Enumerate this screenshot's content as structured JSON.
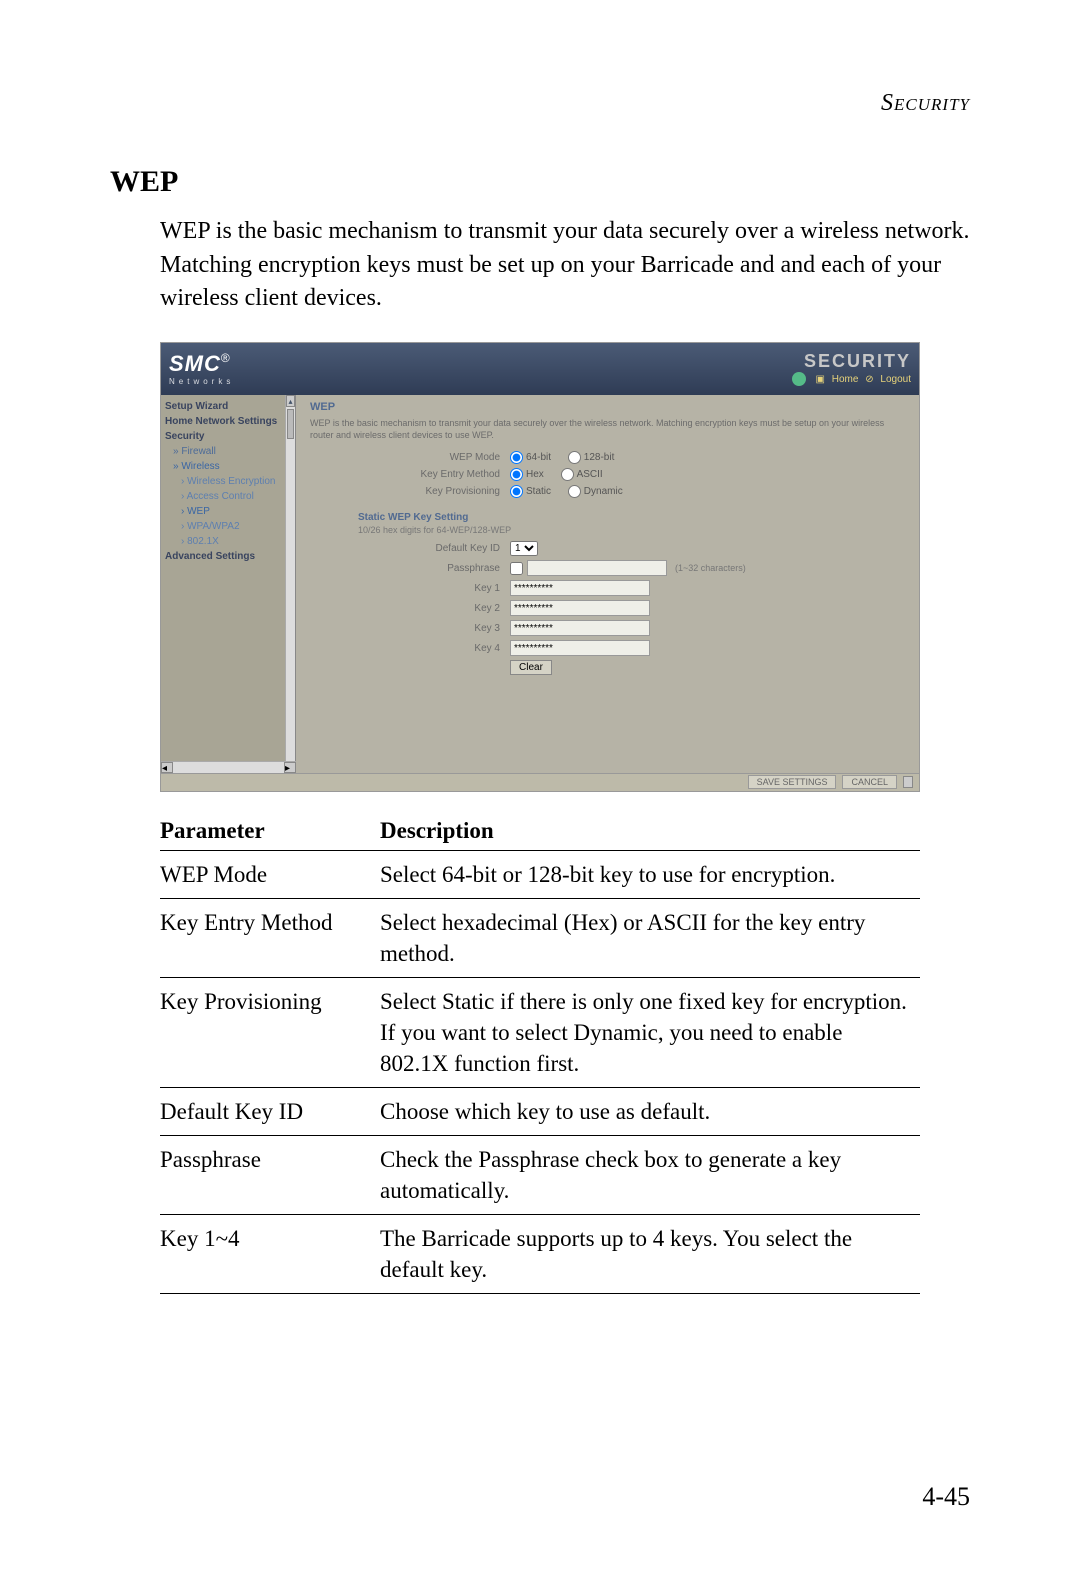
{
  "page": {
    "breadcrumb": "Security",
    "section_title": "WEP",
    "intro": "WEP is the basic mechanism to transmit your data securely over a wireless network. Matching encryption keys must be set up on your Barricade and and each of your wireless client devices.",
    "page_number": "4-45"
  },
  "screenshot": {
    "logo": "SMC",
    "logo_sub": "Networks",
    "banner_title": "SECURITY",
    "link_home": "Home",
    "link_logout": "Logout",
    "sidebar": {
      "items": [
        {
          "label": "Setup Wizard",
          "cls": "top-item"
        },
        {
          "label": "Home Network Settings",
          "cls": "top-item"
        },
        {
          "label": "Security",
          "cls": "top-item"
        },
        {
          "label": "Firewall",
          "cls": "sub"
        },
        {
          "label": "Wireless",
          "cls": "sub active"
        },
        {
          "label": "Wireless Encryption",
          "cls": "sub2"
        },
        {
          "label": "Access Control",
          "cls": "sub2"
        },
        {
          "label": "WEP",
          "cls": "sub2 active"
        },
        {
          "label": "WPA/WPA2",
          "cls": "sub2"
        },
        {
          "label": "802.1X",
          "cls": "sub2"
        },
        {
          "label": "Advanced Settings",
          "cls": "top-item"
        }
      ]
    },
    "content": {
      "title": "WEP",
      "desc": "WEP is the basic mechanism to transmit your data securely over the wireless network. Matching encryption keys must be setup on your wireless router and wireless client devices to use WEP.",
      "wep_mode_label": "WEP Mode",
      "wep_mode_opt1": "64-bit",
      "wep_mode_opt2": "128-bit",
      "entry_label": "Key Entry Method",
      "entry_opt1": "Hex",
      "entry_opt2": "ASCII",
      "prov_label": "Key Provisioning",
      "prov_opt1": "Static",
      "prov_opt2": "Dynamic",
      "static_head": "Static WEP Key Setting",
      "hint": "10/26 hex digits for 64-WEP/128-WEP",
      "default_key_label": "Default Key ID",
      "default_key_value": "1",
      "pass_label": "Passphrase",
      "pass_note": "(1~32 characters)",
      "key1_label": "Key 1",
      "key2_label": "Key 2",
      "key3_label": "Key 3",
      "key4_label": "Key 4",
      "key_value": "**********",
      "clear_btn": "Clear",
      "save_btn": "SAVE SETTINGS",
      "cancel_btn": "CANCEL"
    }
  },
  "table": {
    "h1": "Parameter",
    "h2": "Description",
    "rows": [
      {
        "p": "WEP Mode",
        "d": "Select 64-bit or 128-bit key to use for encryption."
      },
      {
        "p": "Key Entry Method",
        "d": "Select hexadecimal (Hex) or ASCII for the key entry method."
      },
      {
        "p": "Key Provisioning",
        "d": "Select Static if there is only one fixed key for encryption. If you want to select Dynamic, you need to enable 802.1X function first."
      },
      {
        "p": "Default Key ID",
        "d": "Choose which key to use as default."
      },
      {
        "p": "Passphrase",
        "d": "Check the Passphrase check box to generate a key automatically."
      },
      {
        "p": "Key 1~4",
        "d": "The Barricade supports up to 4 keys. You select the default key."
      }
    ]
  }
}
